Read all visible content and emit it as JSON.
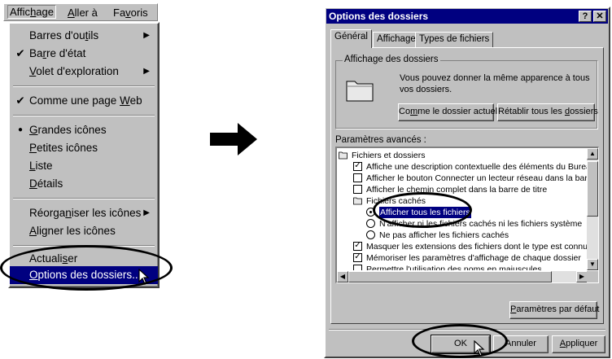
{
  "menubar": {
    "items": [
      {
        "pre": "Affic",
        "key": "h",
        "post": "age"
      },
      {
        "pre": "",
        "key": "A",
        "post": "ller à"
      },
      {
        "pre": "Fa",
        "key": "v",
        "post": "oris"
      }
    ]
  },
  "menu": {
    "items": [
      {
        "pre": "Barres d'ou",
        "key": "t",
        "post": "ils",
        "mark": "",
        "submenu": true
      },
      {
        "pre": "Ba",
        "key": "r",
        "post": "re d'état",
        "mark": "✔",
        "submenu": false
      },
      {
        "pre": "",
        "key": "V",
        "post": "olet d'exploration",
        "mark": "",
        "submenu": true
      },
      {
        "pre": "Comme une page ",
        "key": "W",
        "post": "eb",
        "mark": "✔",
        "submenu": false
      },
      {
        "pre": "",
        "key": "G",
        "post": "randes icônes",
        "mark": "●",
        "submenu": false
      },
      {
        "pre": "",
        "key": "P",
        "post": "etites icônes",
        "mark": "",
        "submenu": false
      },
      {
        "pre": "",
        "key": "L",
        "post": "iste",
        "mark": "",
        "submenu": false
      },
      {
        "pre": "",
        "key": "D",
        "post": "étails",
        "mark": "",
        "submenu": false
      },
      {
        "pre": "Réorga",
        "key": "n",
        "post": "iser les icônes",
        "mark": "",
        "submenu": true
      },
      {
        "pre": "",
        "key": "A",
        "post": "ligner les icônes",
        "mark": "",
        "submenu": false
      },
      {
        "pre": "Actuali",
        "key": "s",
        "post": "er",
        "mark": "",
        "submenu": false
      },
      {
        "pre": "",
        "key": "O",
        "post": "ptions des dossiers...",
        "mark": "",
        "submenu": false
      }
    ]
  },
  "dialog": {
    "title": "Options des dossiers",
    "help_label": "?",
    "close_label": "✕",
    "tabs": [
      "Général",
      "Affichage",
      "Types de fichiers"
    ],
    "group_label": "Affichage des dossiers",
    "group_text": "Vous pouvez donner la même apparence à tous vos dossiers.",
    "btn_current": {
      "pre": "Co",
      "key": "m",
      "post": "me le dossier actuel"
    },
    "btn_reset": {
      "pre": "Rétablir tous les ",
      "key": "d",
      "post": "ossiers"
    },
    "advanced_label": "Paramètres avancés :",
    "tree": [
      {
        "type": "folder",
        "indent": 0,
        "label": "Fichiers et dossiers"
      },
      {
        "type": "check",
        "checked": true,
        "indent": 1,
        "label": "Affiche une description contextuelle des éléments du Bureau"
      },
      {
        "type": "check",
        "checked": false,
        "indent": 1,
        "label": "Afficher le bouton Connecter un lecteur réseau dans la barre"
      },
      {
        "type": "check",
        "checked": false,
        "indent": 1,
        "label": "Afficher le chemin complet dans la barre de titre"
      },
      {
        "type": "folder",
        "indent": 1,
        "label": "Fichiers cachés"
      },
      {
        "type": "radio",
        "checked": true,
        "selected": true,
        "indent": 2,
        "label": "Afficher tous les fichiers"
      },
      {
        "type": "radio",
        "checked": false,
        "indent": 2,
        "label": "N'afficher ni les fichiers cachés ni les fichiers système"
      },
      {
        "type": "radio",
        "checked": false,
        "indent": 2,
        "label": "Ne pas afficher les fichiers cachés"
      },
      {
        "type": "check",
        "checked": true,
        "indent": 1,
        "label": "Masquer les extensions des fichiers dont le type est connu"
      },
      {
        "type": "check",
        "checked": true,
        "indent": 1,
        "label": "Mémoriser les paramètres d'affichage de chaque dossier"
      },
      {
        "type": "check",
        "checked": false,
        "indent": 1,
        "label": "Permettre l'utilisation des noms en majuscules"
      }
    ],
    "btn_defaults": {
      "pre": "",
      "key": "P",
      "post": "aramètres par défaut"
    },
    "btn_ok": "OK",
    "btn_cancel": "Annuler",
    "btn_apply": {
      "pre": "",
      "key": "A",
      "post": "ppliquer"
    }
  },
  "icons": {
    "arrow": "right-arrow-icon",
    "folder": "folder-icon",
    "cursor": "pointer-cursor-icon"
  }
}
